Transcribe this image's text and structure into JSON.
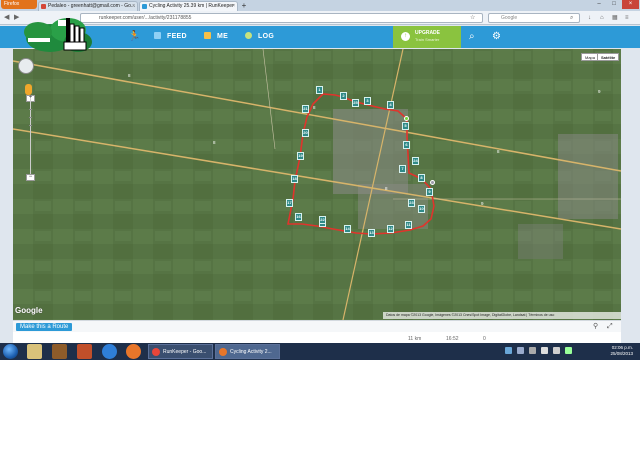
{
  "browser": {
    "app_button": "Firefox",
    "tabs": [
      {
        "label": "Pedaleo - greenhatt@gmail.com - Go...",
        "active": false
      },
      {
        "label": "Cycling Activity 25.39 km | RunKeeper",
        "active": true
      }
    ],
    "new_tab": "+",
    "url": "runkeeper.com/user/.../activity/231178855",
    "search_placeholder": "Google"
  },
  "site_nav": {
    "feed": "FEED",
    "me": "ME",
    "log": "LOG",
    "upgrade_title": "UPGRADE",
    "upgrade_subtitle": "Train Smarter"
  },
  "map": {
    "type_map": "Mapa",
    "type_satellite": "Satélite",
    "zoom_in": "+",
    "zoom_out": "−",
    "google_logo": "Google",
    "attribution": "Datos de mapa ©2013 Google, Imágenes ©2013 Cnes/Spot Image, DigitalGlobe, Landsat | Términos de uso",
    "route_color": "#e0342c",
    "road_labels": [
      "8",
      "8",
      "8",
      "9",
      "8",
      "8",
      "9"
    ],
    "waypoints": [
      "1",
      "2",
      "3",
      "4",
      "5",
      "6",
      "7",
      "8",
      "9",
      "10",
      "11",
      "12",
      "13",
      "14",
      "15",
      "16",
      "17",
      "18",
      "19",
      "20",
      "21",
      "22",
      "23",
      "24",
      "25"
    ]
  },
  "route_bar": {
    "make_route": "Make this a Route"
  },
  "stats": {
    "distance": "11 km",
    "time": "16:52",
    "value": "0"
  },
  "taskbar": {
    "tasks": [
      {
        "label": "RunKeeper - Goo...",
        "color": "#e8463a"
      },
      {
        "label": "Cycling Activity 2...",
        "color": "#e8762a"
      }
    ],
    "time": "02:06 p.m.",
    "date": "25/08/2013"
  },
  "colors": {
    "runkeeper_blue": "#2d9ad7",
    "upgrade_green": "#8ac33f",
    "waypoint_teal": "#2f8a88",
    "satellite_green": "#5f7c4a"
  }
}
